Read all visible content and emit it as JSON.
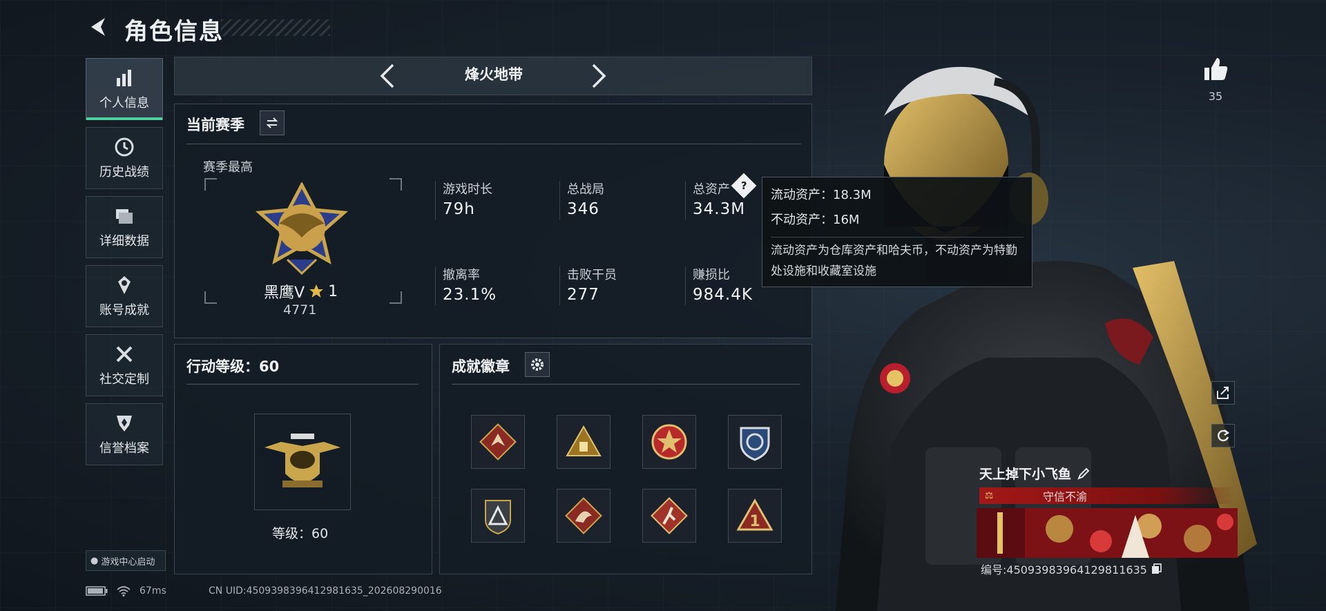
{
  "header": {
    "title": "角色信息"
  },
  "sidebar": {
    "items": [
      {
        "label": "个人信息",
        "icon": "bar-chart-icon",
        "active": true
      },
      {
        "label": "历史战绩",
        "icon": "clock-icon"
      },
      {
        "label": "详细数据",
        "icon": "folder-icon"
      },
      {
        "label": "账号成就",
        "icon": "achievement-icon"
      },
      {
        "label": "社交定制",
        "icon": "tools-icon"
      },
      {
        "label": "信誉档案",
        "icon": "shield-icon"
      }
    ],
    "launch_label": "游戏中心启动"
  },
  "mode": {
    "title": "烽火地带"
  },
  "season": {
    "title": "当前赛季",
    "best_label": "赛季最高",
    "rank_name": "黑鹰Ⅴ",
    "rank_stars": "1",
    "rank_points": "4771",
    "stats": [
      {
        "label": "游戏时长",
        "value": "79h"
      },
      {
        "label": "总战局",
        "value": "346"
      },
      {
        "label": "总资产",
        "value": "34.3M"
      },
      {
        "label": "撤离率",
        "value": "23.1%"
      },
      {
        "label": "击败干员",
        "value": "277"
      },
      {
        "label": "赚损比",
        "value": "984.4K"
      }
    ]
  },
  "tooltip": {
    "liquid": "流动资产：18.3M",
    "fixed": "不动资产：16M",
    "description": "流动资产为仓库资产和哈夫币，不动资产为特勤处设施和收藏室设施"
  },
  "action_level": {
    "title": "行动等级：60",
    "level_label": "等级：60"
  },
  "badges": {
    "title": "成就徽章",
    "items": [
      "wolf-badge-icon",
      "triangle-badge-icon",
      "star-medal-icon",
      "shield-badge-icon",
      "pyramid-badge-icon",
      "dragon-badge-icon",
      "runner-badge-icon",
      "number-one-badge-icon"
    ]
  },
  "profile": {
    "likes": "35",
    "player_name": "天上掉下小飞鱼",
    "title_tag": "守信不渝",
    "uid_label": "编号:4509398396412981163​5"
  },
  "status": {
    "ping": "67ms",
    "uid": "CN UID:4509398396412981635_202608290016"
  },
  "colors": {
    "accent": "#4ed0a0",
    "panel": "#141c24",
    "tag_red": "#8b1a1a"
  }
}
